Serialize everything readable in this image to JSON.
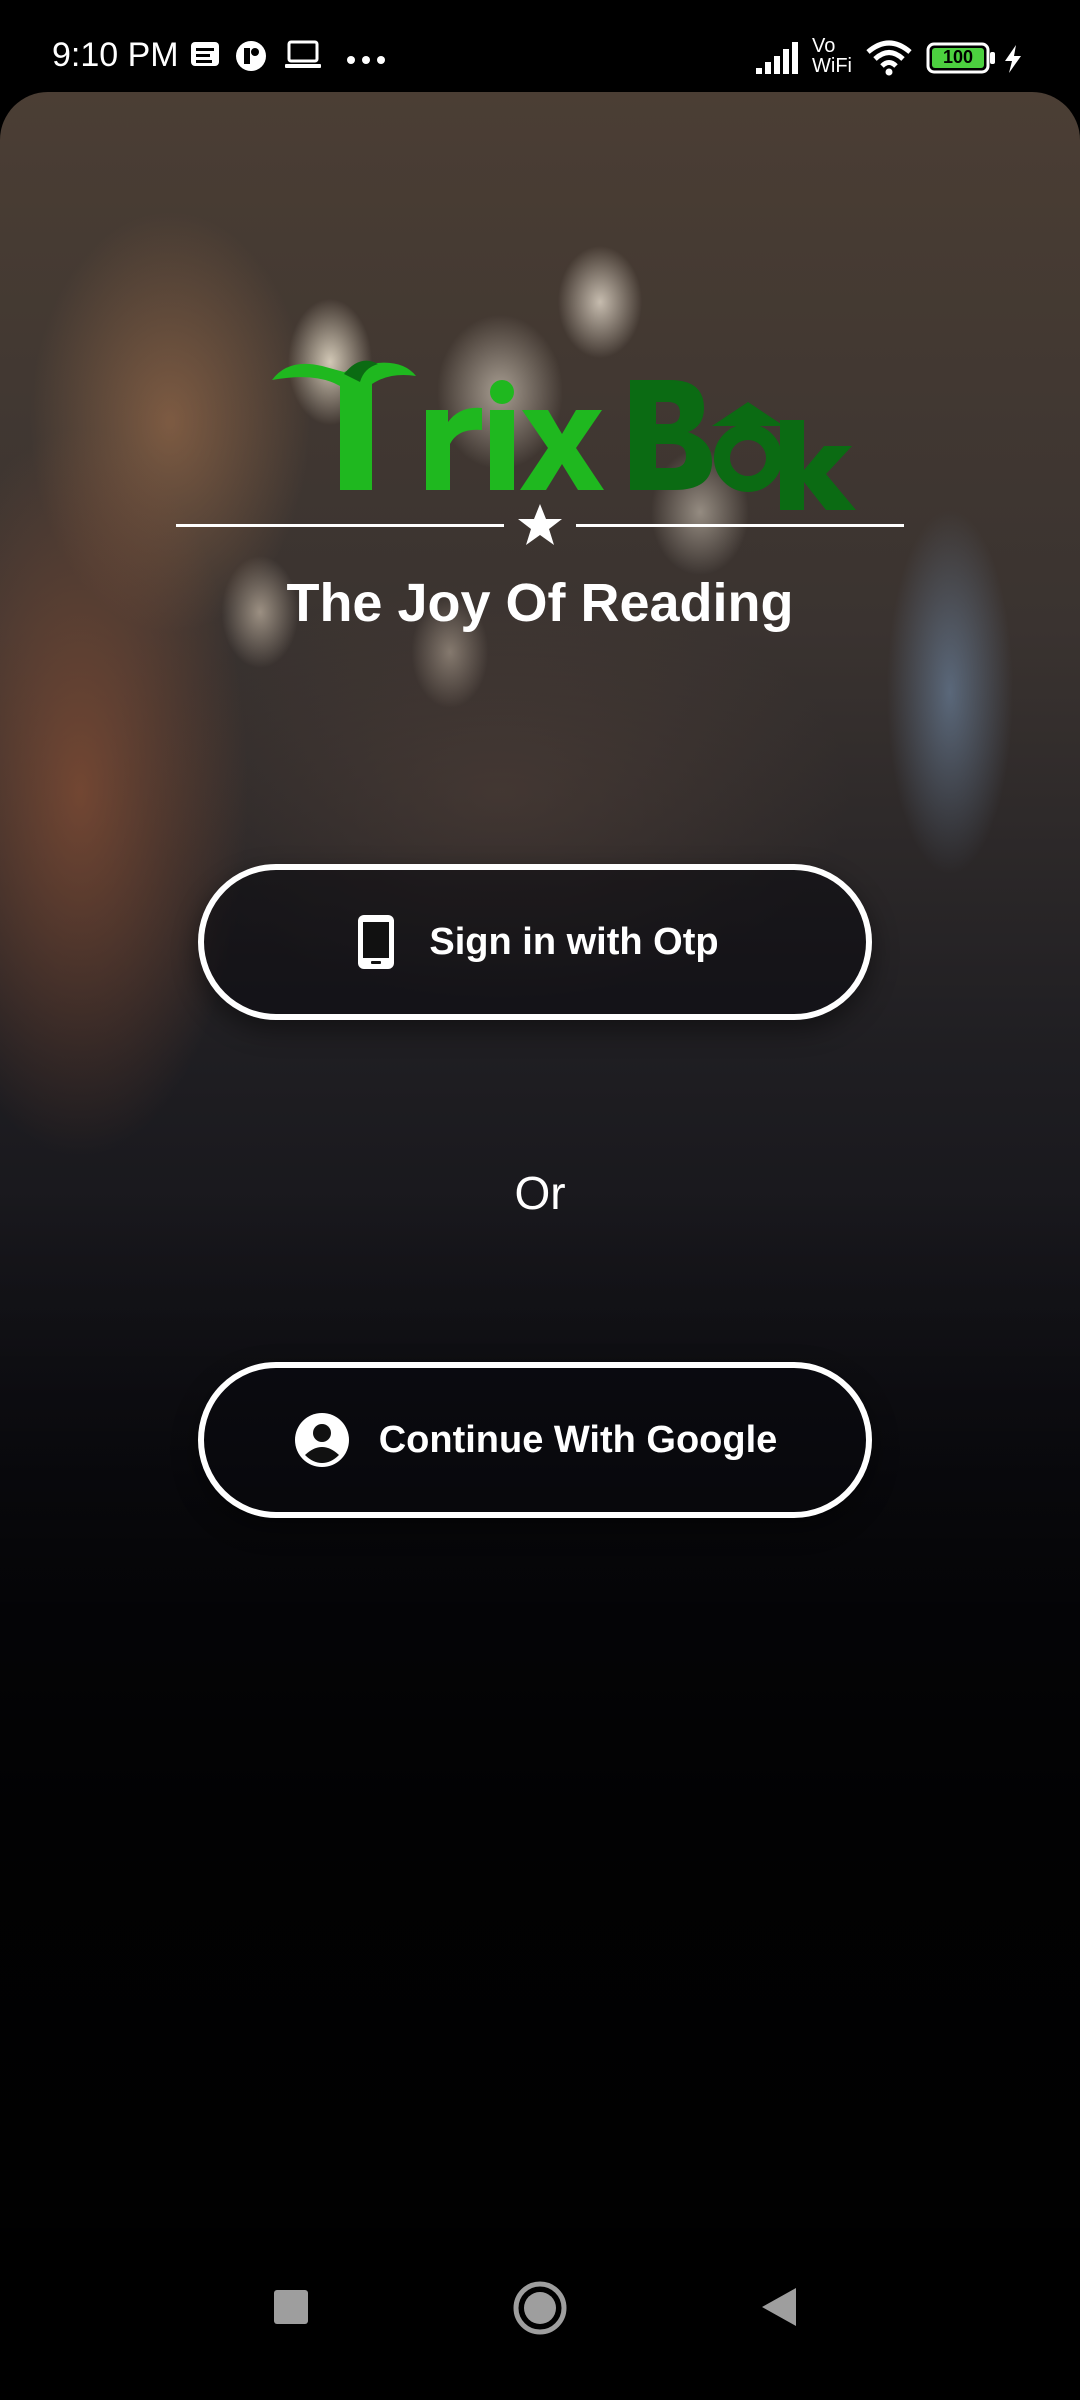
{
  "status_bar": {
    "time": "9:10 PM",
    "battery_level": "100",
    "network_label_top": "Vo",
    "network_label_bottom": "WiFi",
    "icons": [
      "message-icon",
      "app-icon",
      "laptop-icon",
      "more-icon",
      "signal-icon",
      "wifi-icon",
      "battery-icon",
      "charging-icon"
    ]
  },
  "brand": {
    "logo_text": "Trix Book",
    "tagline": "The Joy Of Reading",
    "logo_green": "#1fb81f",
    "logo_dark_green": "#0b6b13"
  },
  "auth": {
    "otp_button_label": "Sign in with Otp",
    "separator": "Or",
    "google_button_label": "Continue With Google"
  },
  "nav_bar": {
    "icons": [
      "recents-icon",
      "home-icon",
      "back-icon"
    ]
  }
}
